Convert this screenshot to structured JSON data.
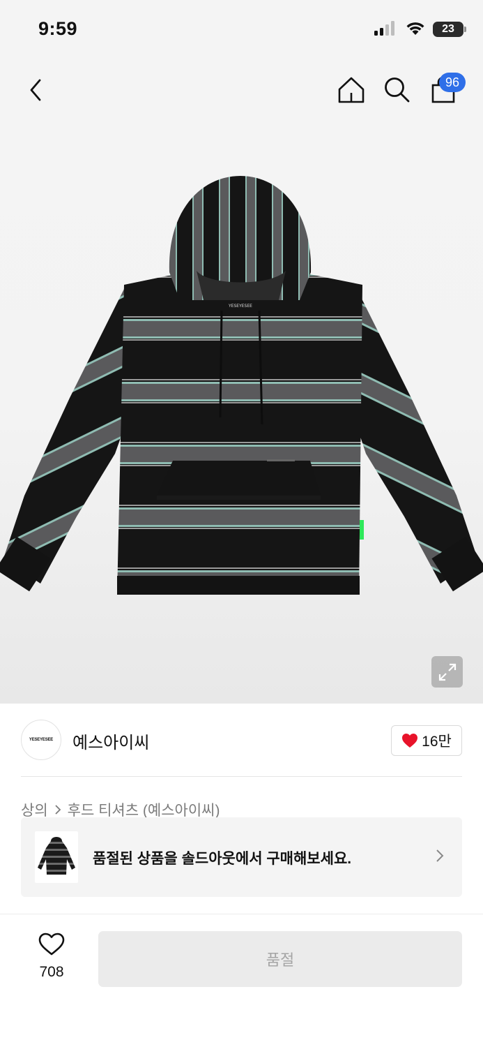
{
  "status_bar": {
    "time": "9:59",
    "battery": "23",
    "icons": [
      "cellular-signal-icon",
      "wifi-icon",
      "battery-icon"
    ]
  },
  "nav": {
    "icons": [
      "back-arrow-icon",
      "home-icon",
      "search-icon",
      "shopping-bag-icon"
    ],
    "cart_count": "96",
    "badge_color": "#2f6fe8"
  },
  "product": {
    "image_alt": "black hoodie with gray and mint horizontal stripes",
    "hood_label": "YESEYESEE",
    "expand_icon": "expand-arrows-icon"
  },
  "brand": {
    "logo_text": "YESEYESEE",
    "name": "예스아이씨",
    "like_icon": "heart-filled-icon",
    "like_count": "16만",
    "like_color": "#e8132a"
  },
  "breadcrumb": {
    "category": "상의",
    "subcategory": "후드 티셔츠 (예스아이씨)",
    "separator_icon": "chevron-right-icon"
  },
  "soldout_banner": {
    "message": "품절된 상품을 솔드아웃에서 구매해보세요.",
    "chevron_icon": "chevron-right-icon"
  },
  "bottom_bar": {
    "wish_icon": "heart-outline-icon",
    "wish_count": "708",
    "button_label": "품절"
  }
}
